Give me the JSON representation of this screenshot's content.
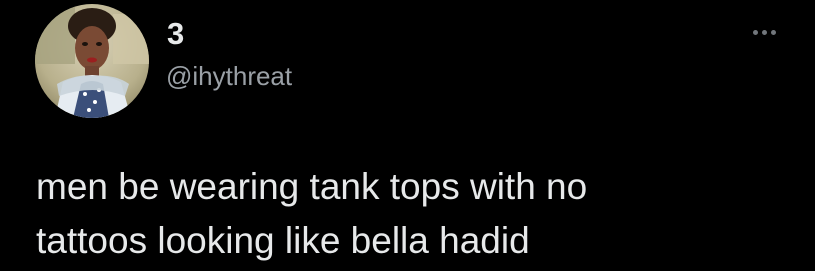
{
  "tweet": {
    "author": {
      "display_name": "3",
      "handle": "@ihythreat",
      "avatar_icon": "profile-photo"
    },
    "more_icon": "more-options-icon",
    "text_lines": [
      "men be wearing tank tops with no",
      "tattoos looking like bella hadid"
    ]
  },
  "colors": {
    "background": "#000000",
    "primary_text": "#e7e9ea",
    "secondary_text": "#9aa0a6",
    "icon": "#71767b"
  }
}
